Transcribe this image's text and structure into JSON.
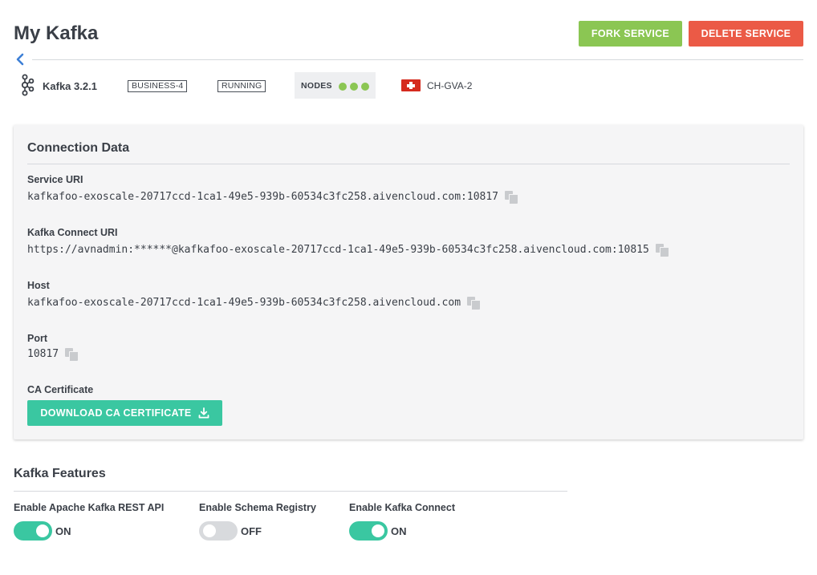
{
  "page": {
    "title": "My Kafka"
  },
  "actions": {
    "fork_label": "FORK SERVICE",
    "delete_label": "DELETE SERVICE"
  },
  "service": {
    "product": "Kafka 3.2.1",
    "plan": "BUSINESS-4",
    "state": "RUNNING",
    "nodes_label": "NODES",
    "nodes_count": 3,
    "region": "CH-GVA-2"
  },
  "connection": {
    "title": "Connection Data",
    "service_uri_label": "Service URI",
    "service_uri": "kafkafoo-exoscale-20717ccd-1ca1-49e5-939b-60534c3fc258.aivencloud.com:10817",
    "connect_uri_label": "Kafka Connect URI",
    "connect_uri": "https://avnadmin:******@kafkafoo-exoscale-20717ccd-1ca1-49e5-939b-60534c3fc258.aivencloud.com:10815",
    "host_label": "Host",
    "host": "kafkafoo-exoscale-20717ccd-1ca1-49e5-939b-60534c3fc258.aivencloud.com",
    "port_label": "Port",
    "port": "10817",
    "ca_label": "CA Certificate",
    "download_label": "DOWNLOAD CA CERTIFICATE"
  },
  "features": {
    "title": "Kafka Features",
    "items": [
      {
        "label": "Enable Apache Kafka REST API",
        "state": "ON"
      },
      {
        "label": "Enable Schema Registry",
        "state": "OFF"
      },
      {
        "label": "Enable Kafka Connect",
        "state": "ON"
      }
    ]
  },
  "colors": {
    "fork": "#8bc653",
    "delete": "#eb5a46",
    "accent": "#3ac7a1",
    "node_ok": "#8bc653",
    "back_arrow": "#3d7fd6"
  }
}
